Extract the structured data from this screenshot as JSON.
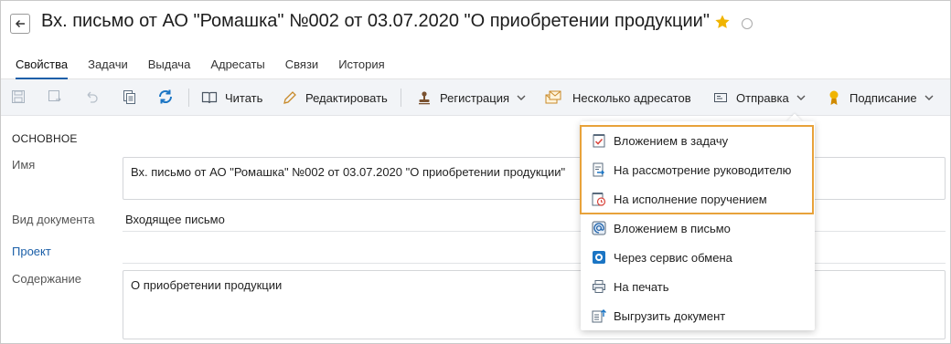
{
  "header": {
    "title": "Вх. письмо от АО \"Ромашка\" №002 от 03.07.2020 \"О приобретении продукции\""
  },
  "tabs": [
    {
      "label": "Свойства",
      "active": true
    },
    {
      "label": "Задачи",
      "active": false
    },
    {
      "label": "Выдача",
      "active": false
    },
    {
      "label": "Адресаты",
      "active": false
    },
    {
      "label": "Связи",
      "active": false
    },
    {
      "label": "История",
      "active": false
    }
  ],
  "toolbar": {
    "read_label": "Читать",
    "edit_label": "Редактировать",
    "registration_label": "Регистрация",
    "multi_addressees_label": "Несколько адресатов",
    "send_label": "Отправка",
    "signing_label": "Подписание"
  },
  "form": {
    "section_title": "ОСНОВНОЕ",
    "name_label": "Имя",
    "name_value": "Вх. письмо от АО \"Ромашка\" №002 от 03.07.2020 \"О приобретении продукции\"",
    "doc_type_label": "Вид документа",
    "doc_type_value": "Входящее письмо",
    "project_label": "Проект",
    "content_label": "Содержание",
    "content_value": "О приобретении продукции"
  },
  "send_menu": {
    "items": [
      {
        "label": "Вложением в задачу",
        "icon": "task-attachment-icon"
      },
      {
        "label": "На рассмотрение руководителю",
        "icon": "forward-to-manager-icon"
      },
      {
        "label": "На исполнение поручением",
        "icon": "assignment-clock-icon"
      },
      {
        "label": "Вложением в письмо",
        "icon": "email-at-icon"
      },
      {
        "label": "Через сервис обмена",
        "icon": "exchange-service-icon"
      },
      {
        "label": "На печать",
        "icon": "printer-icon"
      },
      {
        "label": "Выгрузить документ",
        "icon": "export-document-icon"
      }
    ]
  },
  "colors": {
    "accent": "#1b5fa8",
    "highlight": "#e8a23a",
    "star": "#f0b400"
  }
}
